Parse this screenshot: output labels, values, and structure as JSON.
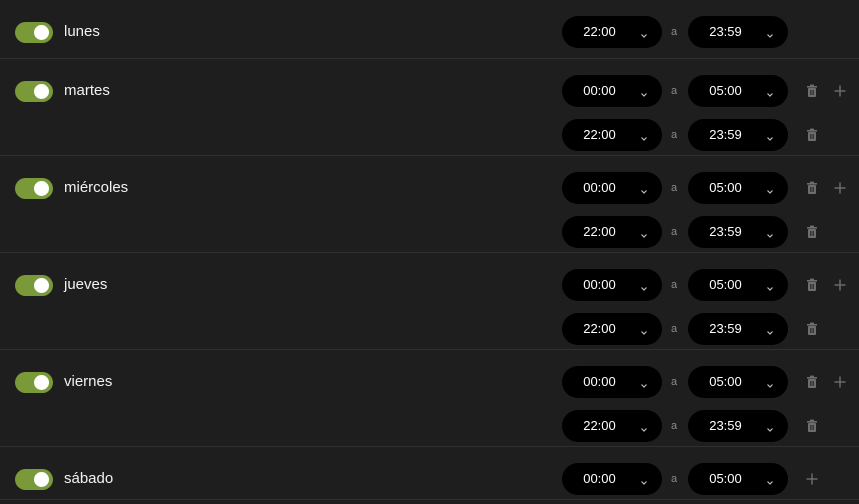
{
  "separator": "a",
  "colors": {
    "background": "#1e1e1e",
    "toggle_on": "#7a9a3a",
    "select_bg": "#000000",
    "icon": "#6e6e6e"
  },
  "days": [
    {
      "label": "lunes",
      "enabled": true,
      "slots": [
        {
          "from": "22:00",
          "to": "23:59"
        }
      ]
    },
    {
      "label": "martes",
      "enabled": true,
      "slots": [
        {
          "from": "00:00",
          "to": "05:00"
        },
        {
          "from": "22:00",
          "to": "23:59"
        }
      ]
    },
    {
      "label": "miércoles",
      "enabled": true,
      "slots": [
        {
          "from": "00:00",
          "to": "05:00"
        },
        {
          "from": "22:00",
          "to": "23:59"
        }
      ]
    },
    {
      "label": "jueves",
      "enabled": true,
      "slots": [
        {
          "from": "00:00",
          "to": "05:00"
        },
        {
          "from": "22:00",
          "to": "23:59"
        }
      ]
    },
    {
      "label": "viernes",
      "enabled": true,
      "slots": [
        {
          "from": "00:00",
          "to": "05:00"
        },
        {
          "from": "22:00",
          "to": "23:59"
        }
      ]
    },
    {
      "label": "sábado",
      "enabled": true,
      "slots": [
        {
          "from": "00:00",
          "to": "05:00"
        }
      ]
    }
  ]
}
